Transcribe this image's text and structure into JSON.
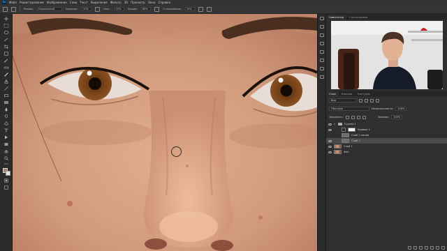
{
  "menu": {
    "logo": "Ps",
    "items": [
      "Файл",
      "Редактирование",
      "Изображение",
      "Слои",
      "Текст",
      "Выделение",
      "Фильтр",
      "3D",
      "Просмотр",
      "Окно",
      "Справка"
    ]
  },
  "options": {
    "mode_label": "Режим:",
    "mode_value": "Нормальный",
    "opacity_label": "Непрозр.:",
    "opacity_value": "20%",
    "pressure_label": "Наж.:",
    "pressure_value": "10%",
    "flow_label": "Нажим:",
    "flow_value": "80%",
    "smooth_label": "Сглаживание:",
    "smooth_value": "10%"
  },
  "navigator": {
    "tabs": [
      "Навигатор",
      "Гистограмма"
    ]
  },
  "layers_panel": {
    "tabs": [
      "Слои",
      "Каналы",
      "Контуры"
    ],
    "filter_kind": "Вид",
    "blend_mode": "Обычные",
    "opacity_label": "Непрозрачность:",
    "opacity_value": "100%",
    "lock_label": "Закрепить:",
    "fill_label": "Заливка:",
    "fill_value": "100%",
    "layers": [
      {
        "name": "Группа 1",
        "kind": "group",
        "selected": false
      },
      {
        "name": "Кривые 1",
        "kind": "adjustment",
        "selected": false
      },
      {
        "name": "Слой 2 копия",
        "kind": "layer",
        "selected": false
      },
      {
        "name": "Слой 2",
        "kind": "layer",
        "selected": true
      },
      {
        "name": "Слой 1",
        "kind": "photo",
        "selected": false
      },
      {
        "name": "Фон",
        "kind": "photo",
        "selected": false
      }
    ]
  },
  "colors": {
    "foreground": "#b57f6a",
    "background": "#e9e2dc",
    "skin": "#d39d7f"
  },
  "icons": [
    "brush-icon",
    "move-icon",
    "marquee-icon",
    "lasso-icon",
    "crop-icon",
    "eyedropper-icon",
    "healing-icon",
    "stamp-icon",
    "eraser-icon",
    "gradient-icon",
    "pen-icon",
    "text-icon",
    "hand-icon",
    "zoom-icon",
    "eye-icon",
    "folder-icon"
  ]
}
